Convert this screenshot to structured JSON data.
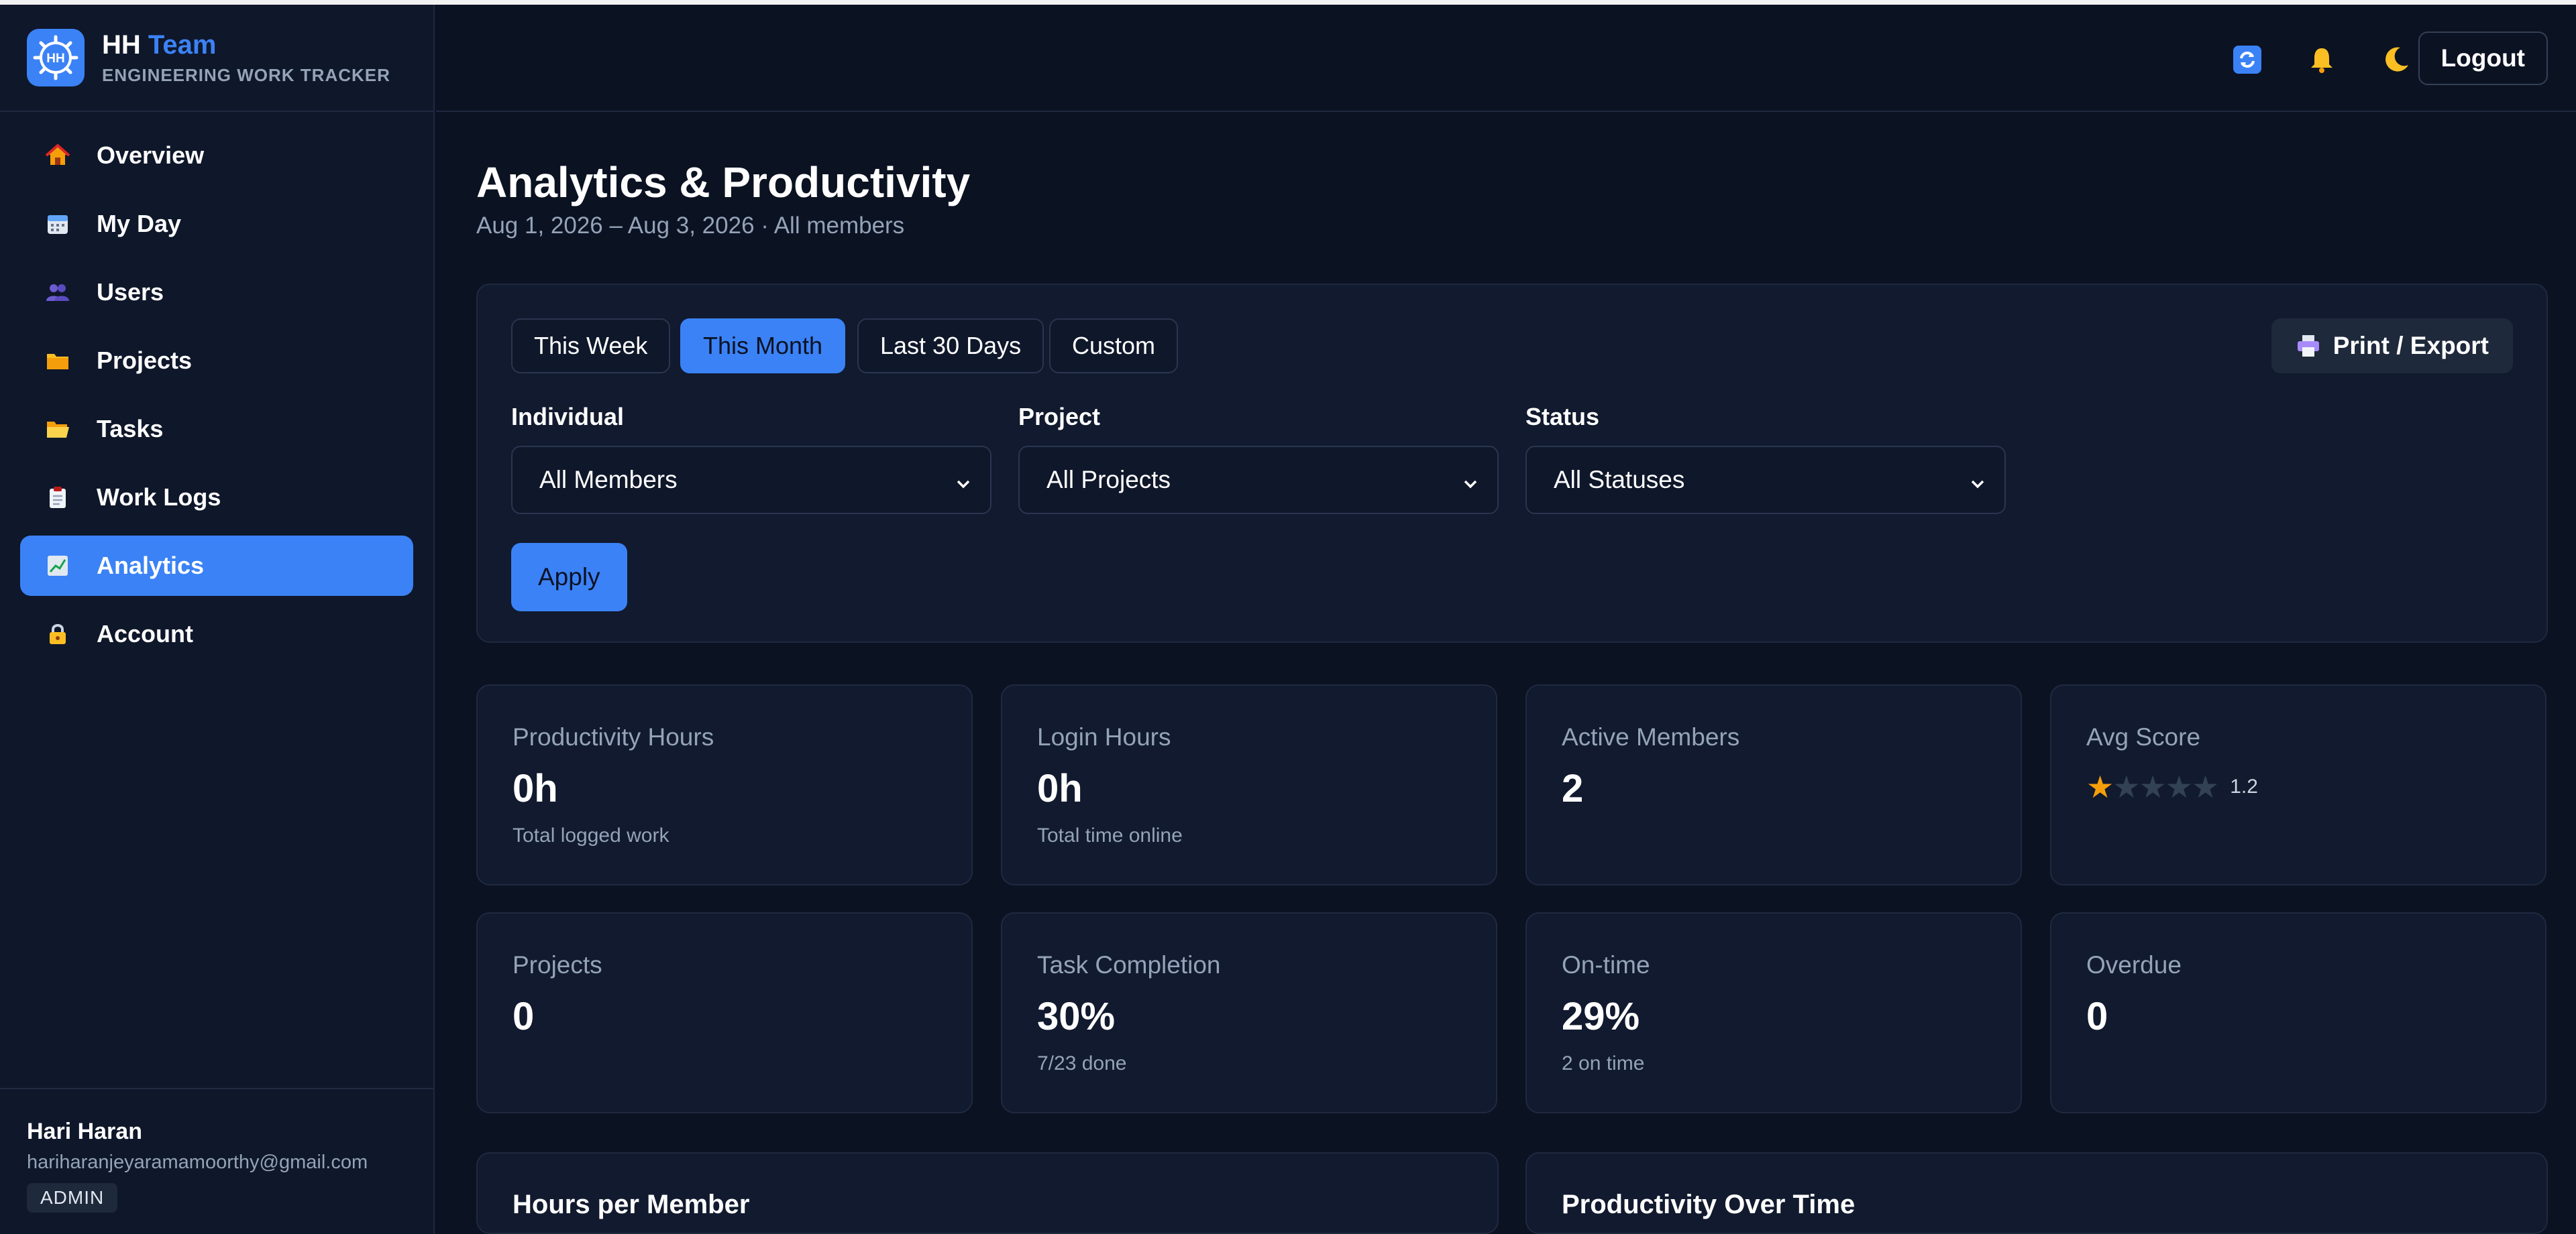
{
  "brand": {
    "logo_text": "HH",
    "name_part1": "HH",
    "name_part2": "Team",
    "subtitle": "ENGINEERING WORK TRACKER"
  },
  "sidebar": {
    "items": [
      {
        "label": "Overview",
        "icon": "house-icon",
        "active": false
      },
      {
        "label": "My Day",
        "icon": "calendar-icon",
        "active": false
      },
      {
        "label": "Users",
        "icon": "users-icon",
        "active": false
      },
      {
        "label": "Projects",
        "icon": "folder-icon",
        "active": false
      },
      {
        "label": "Tasks",
        "icon": "open-folder-icon",
        "active": false
      },
      {
        "label": "Work Logs",
        "icon": "clipboard-icon",
        "active": false
      },
      {
        "label": "Analytics",
        "icon": "chart-icon",
        "active": true
      },
      {
        "label": "Account",
        "icon": "lock-icon",
        "active": false
      }
    ],
    "user": {
      "name": "Hari Haran",
      "email": "hariharanjeyaramamoorthy@gmail.com",
      "role": "ADMIN"
    }
  },
  "topbar": {
    "icons": [
      "refresh-icon",
      "bell-icon",
      "moon-icon"
    ],
    "logout_label": "Logout"
  },
  "page": {
    "title": "Analytics & Productivity",
    "subtitle": "Aug 1, 2026 – Aug 3, 2026 · All members"
  },
  "filters": {
    "ranges": [
      {
        "label": "This Week",
        "active": false
      },
      {
        "label": "This Month",
        "active": true
      },
      {
        "label": "Last 30 Days",
        "active": false
      },
      {
        "label": "Custom",
        "active": false
      }
    ],
    "print_label": "Print / Export",
    "individual": {
      "label": "Individual",
      "value": "All Members"
    },
    "project": {
      "label": "Project",
      "value": "All Projects"
    },
    "status": {
      "label": "Status",
      "value": "All Statuses"
    },
    "apply_label": "Apply"
  },
  "stats": {
    "productivity": {
      "label": "Productivity Hours",
      "value": "0h",
      "sub": "Total logged work"
    },
    "login": {
      "label": "Login Hours",
      "value": "0h",
      "sub": "Total time online"
    },
    "active": {
      "label": "Active Members",
      "value": "2"
    },
    "avg_score": {
      "label": "Avg Score",
      "score": "1.2",
      "stars_filled": 1,
      "stars_total": 5
    },
    "projects": {
      "label": "Projects",
      "value": "0"
    },
    "task_completion": {
      "label": "Task Completion",
      "value": "30%",
      "sub": "7/23 done"
    },
    "ontime": {
      "label": "On-time",
      "value": "29%",
      "sub": "2 on time"
    },
    "overdue": {
      "label": "Overdue",
      "value": "0"
    }
  },
  "sections": {
    "hours_per_member": "Hours per Member",
    "productivity_over_time": "Productivity Over Time"
  },
  "colors": {
    "accent": "#3b82f6",
    "background": "#0b1222",
    "card": "#111a2e",
    "star": "#f59e0b"
  }
}
